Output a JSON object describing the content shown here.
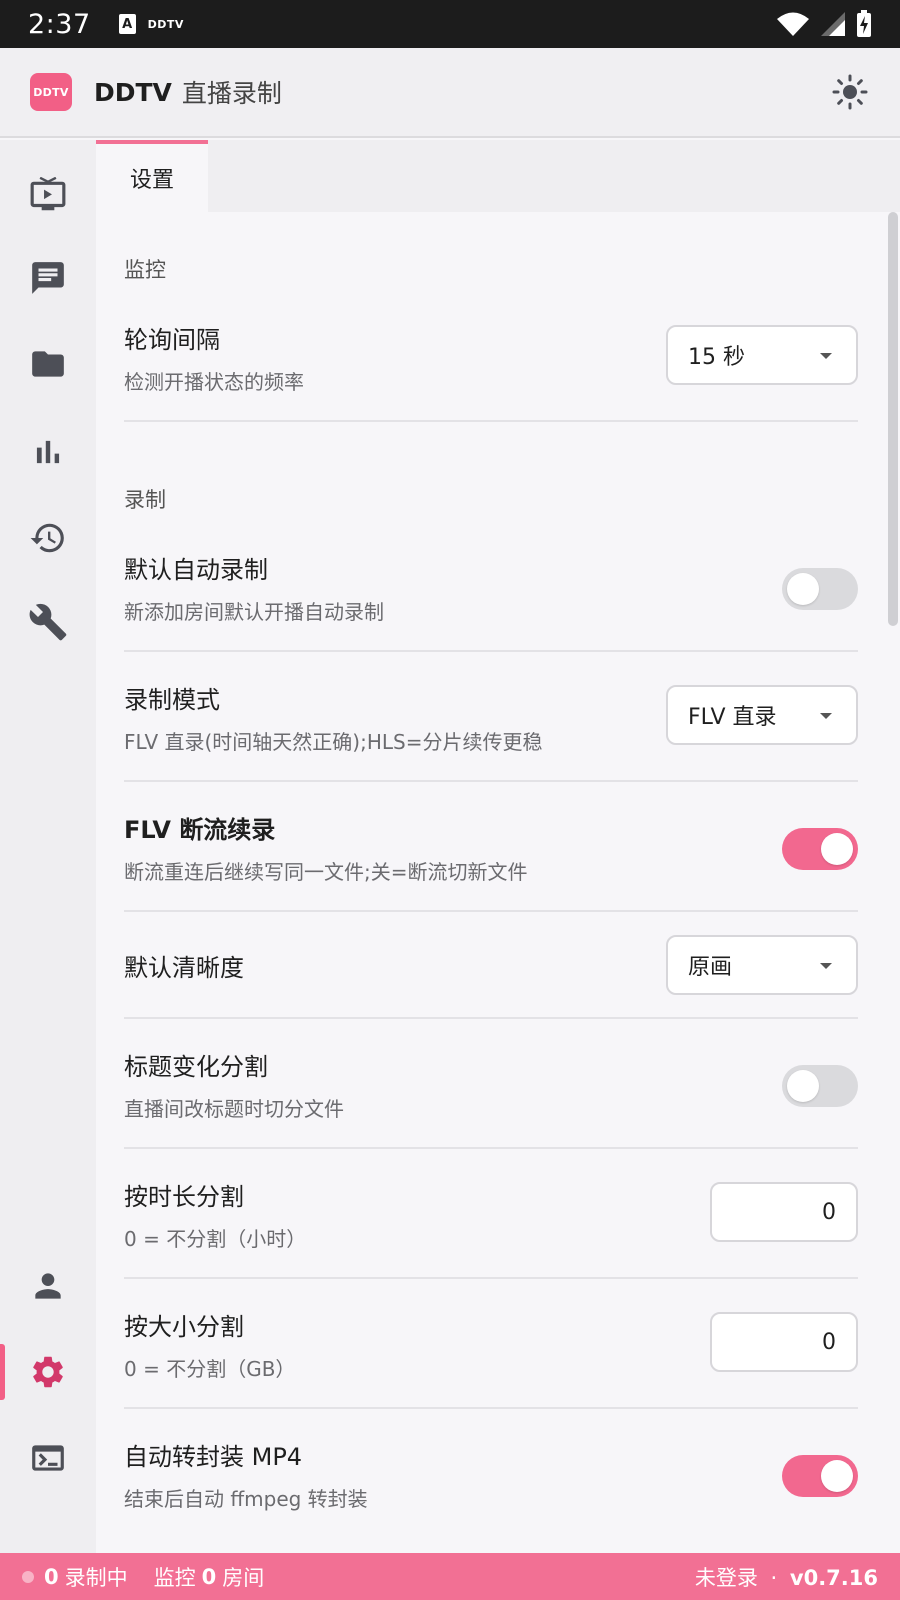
{
  "status_bar": {
    "time": "2:37",
    "notif_a": "A",
    "notif_app": "DDTV"
  },
  "app": {
    "logo_text": "DDTV",
    "title": "DDTV",
    "subtitle": "直播录制"
  },
  "tab": {
    "label": "设置"
  },
  "sections": {
    "monitor": "监控",
    "record": "录制"
  },
  "settings": {
    "poll_interval": {
      "label": "轮询间隔",
      "desc": "检测开播状态的频率",
      "value": "15 秒"
    },
    "auto_record": {
      "label": "默认自动录制",
      "desc": "新添加房间默认开播自动录制",
      "enabled": false
    },
    "record_mode": {
      "label": "录制模式",
      "desc": "FLV 直录(时间轴天然正确);HLS=分片续传更稳",
      "value": "FLV 直录"
    },
    "flv_resume": {
      "label": "FLV 断流续录",
      "desc": "断流重连后继续写同一文件;关=断流切新文件",
      "enabled": true
    },
    "default_quality": {
      "label": "默认清晰度",
      "value": "原画"
    },
    "title_split": {
      "label": "标题变化分割",
      "desc": "直播间改标题时切分文件",
      "enabled": false
    },
    "duration_split": {
      "label": "按时长分割",
      "desc": "0 = 不分割（小时）",
      "value": "0"
    },
    "size_split": {
      "label": "按大小分割",
      "desc": "0 = 不分割（GB）",
      "value": "0"
    },
    "auto_remux": {
      "label": "自动转封装 MP4",
      "desc": "结束后自动 ffmpeg 转封装",
      "enabled": true
    }
  },
  "footer": {
    "recording_count": "0",
    "recording_label": "录制中",
    "monitor_label": "监控",
    "room_count": "0",
    "room_label": "房间",
    "login_status": "未登录",
    "separator": "·",
    "version": "v0.7.16"
  },
  "colors": {
    "accent": "#f27094",
    "toggle_on": "#f2688f",
    "nav_icon": "#4d4f57",
    "nav_active": "#d2386a"
  }
}
